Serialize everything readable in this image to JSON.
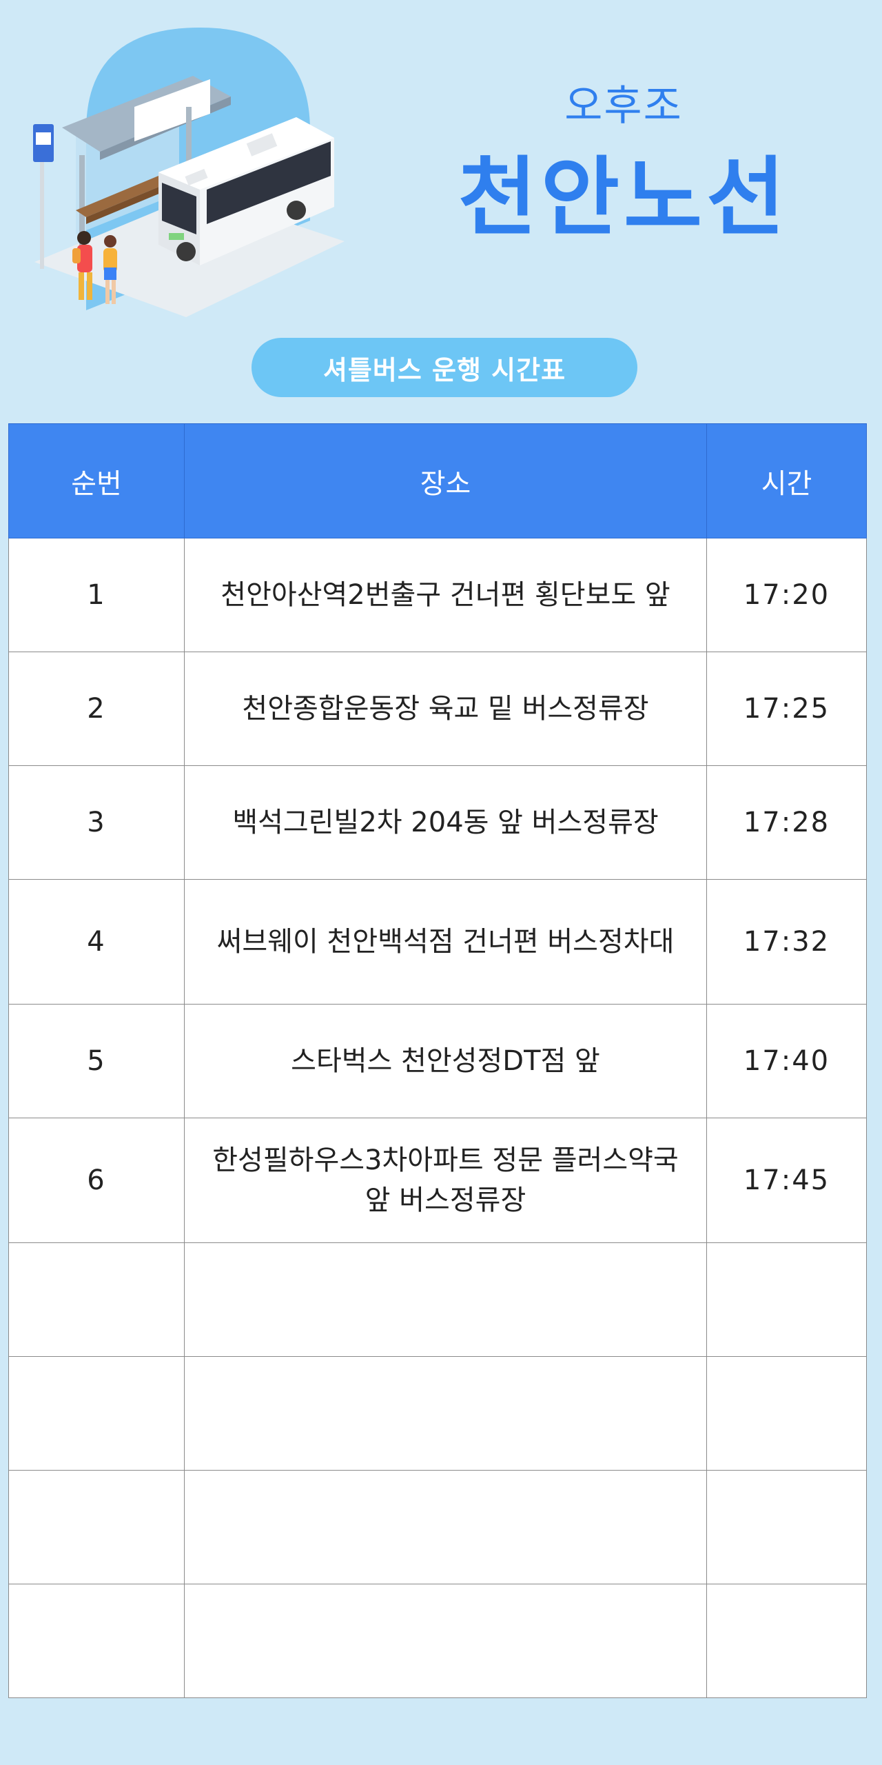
{
  "header": {
    "subtitle": "오후조",
    "title": "천안노선",
    "pill": "셔틀버스 운행 시간표"
  },
  "table": {
    "columns": [
      "순번",
      "장소",
      "시간"
    ],
    "rows": [
      {
        "no": "1",
        "place": "천안아산역2번출구 건너편 횡단보도 앞",
        "time": "17:20"
      },
      {
        "no": "2",
        "place": "천안종합운동장 육교 밑 버스정류장",
        "time": "17:25"
      },
      {
        "no": "3",
        "place": "백석그린빌2차 204동 앞 버스정류장",
        "time": "17:28"
      },
      {
        "no": "4",
        "place": "써브웨이 천안백석점 건너편 버스정차대",
        "time": "17:32"
      },
      {
        "no": "5",
        "place": "스타벅스 천안성정DT점 앞",
        "time": "17:40"
      },
      {
        "no": "6",
        "place": "한성필하우스3차아파트 정문 플러스약국 앞 버스정류장",
        "time": "17:45"
      },
      {
        "no": "",
        "place": "",
        "time": ""
      },
      {
        "no": "",
        "place": "",
        "time": ""
      },
      {
        "no": "",
        "place": "",
        "time": ""
      },
      {
        "no": "",
        "place": "",
        "time": ""
      }
    ]
  },
  "colors": {
    "background": "#cfe9f7",
    "accent": "#2f7fee",
    "header_bg": "#3f86f1",
    "pill_bg": "#6dc6f5"
  },
  "illustration": {
    "icon": "bus-stop-illustration"
  }
}
